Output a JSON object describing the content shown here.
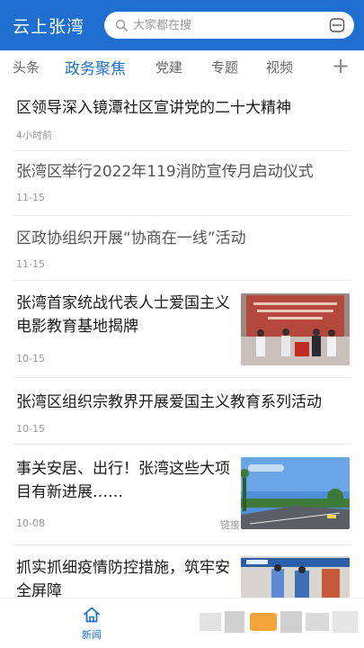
{
  "header": {
    "app_title": "云上张湾",
    "search_placeholder": "大家都在搜",
    "search_icon": "search-icon",
    "scan_icon": "scan-icon"
  },
  "tabs": {
    "items": [
      {
        "label": "头条"
      },
      {
        "label": "政务聚焦",
        "active": true
      },
      {
        "label": "党建"
      },
      {
        "label": "专题"
      },
      {
        "label": "视频"
      }
    ],
    "more_label": "+"
  },
  "news": [
    {
      "title": "区领导深入镜潭社区宣讲党的二十大精神",
      "time": "4小时前"
    },
    {
      "title": "张湾区举行2022年119消防宣传月启动仪式",
      "time": "11-15"
    },
    {
      "title": "区政协组织开展“协商在一线”活动",
      "time": "11-15"
    },
    {
      "title": "张湾首家统战代表人士爱国主义电影教育基地揭牌",
      "time": "10-15",
      "image": "ceremony-photo"
    },
    {
      "title": "张湾区组织宗教界开展爱国主义教育系列活动",
      "time": "10-15"
    },
    {
      "title": "事关安居、出行！张湾这些大项目有新进展……",
      "time": "10-08",
      "tag": "链接",
      "image": "road-photo"
    },
    {
      "title": "抓实抓细疫情防控措施，筑牢安全屏障",
      "image": "checkpoint-photo"
    }
  ],
  "bottom_nav": {
    "home_label": "新闻",
    "home_icon": "home-icon"
  },
  "colors": {
    "brand": "#1f6fd1",
    "text": "#1a1a1a",
    "muted": "#999999"
  }
}
